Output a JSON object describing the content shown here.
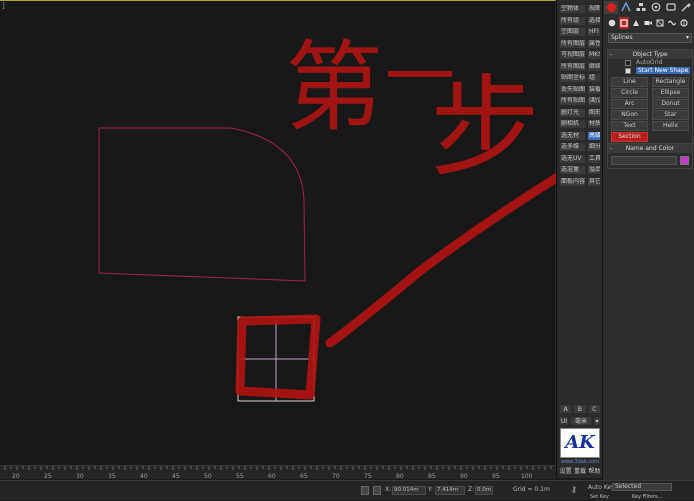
{
  "viewport": {
    "corner_label": "]"
  },
  "annotations": {
    "chars": [
      "第",
      "一",
      "步"
    ]
  },
  "scripts_panel": {
    "rows": [
      {
        "a": "空物体",
        "b": "视图"
      },
      {
        "a": "所有组",
        "b": "选择"
      },
      {
        "a": "空图层",
        "b": "HFI"
      },
      {
        "a": "所有图层",
        "b": "属性"
      },
      {
        "a": "可视图层",
        "b": "MKS"
      },
      {
        "a": "所有图层",
        "b": "继续"
      },
      {
        "a": "贴图坐标",
        "b": "组"
      },
      {
        "a": "丢失贴图",
        "b": "装载"
      },
      {
        "a": "所有贴图",
        "b": "|勘误"
      },
      {
        "a": "删灯光",
        "b": "图形"
      },
      {
        "a": "删相机",
        "b": "材质"
      },
      {
        "a": "选无材",
        "b": "高级"
      },
      {
        "a": "选多维",
        "b": "细分"
      },
      {
        "a": "选无UV",
        "b": "工具"
      },
      {
        "a": "选渲量",
        "b": "溢品"
      },
      {
        "a": "面板内容",
        "b": "其它"
      }
    ],
    "mini_tabs": [
      "A",
      "B",
      "C"
    ],
    "unit_select": [
      "UI",
      "毫米",
      "▾"
    ],
    "logo_text": "AK",
    "logo_caption": "www.3dak.com",
    "bottom_buttons": [
      "设置",
      "重载",
      "帮助"
    ]
  },
  "command_panel": {
    "category_dropdown": "Splines",
    "object_type_title": "Object Type",
    "autogrid_label": "AutoGrid",
    "start_new_shape_label": "Start New Shape",
    "buttons": [
      "Line",
      "Rectangle",
      "Circle",
      "Ellipse",
      "Arc",
      "Donut",
      "NGon",
      "Star",
      "Text",
      "Helix",
      "Section"
    ],
    "active_button": "Section",
    "name_color_title": "Name and Color",
    "swatch_color": "#c43ac4"
  },
  "timeline": {
    "ticks": [
      "20",
      "25",
      "30",
      "35",
      "40",
      "45",
      "50",
      "55",
      "60",
      "65",
      "70",
      "75",
      "80",
      "85",
      "90",
      "95",
      "100"
    ]
  },
  "status_bar": {
    "x_label": "X:",
    "x_value": "90.014m",
    "y_label": "Y:",
    "y_value": "7.414m",
    "z_label": "Z:",
    "z_value": "0.0m",
    "grid_label": "Grid = 0.1m",
    "auto_key": "Auto Key",
    "selected_label": "Selected",
    "set_key": "Set Key",
    "key_filters": "Key Filters..."
  }
}
